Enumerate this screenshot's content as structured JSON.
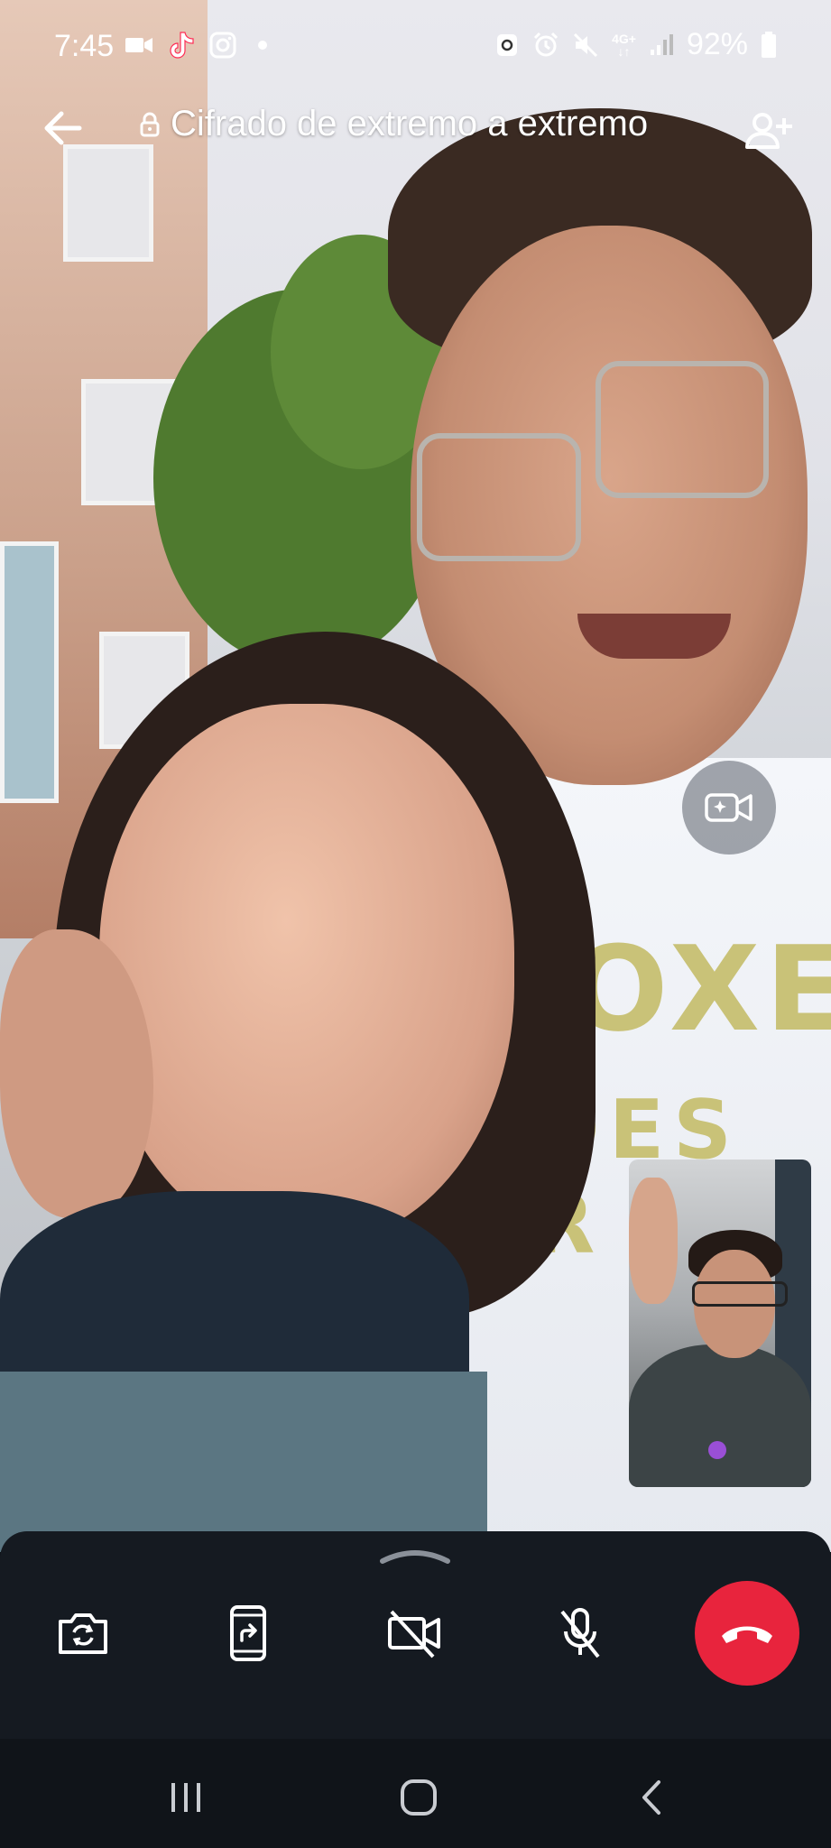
{
  "status_bar": {
    "time": "7:45",
    "network": "4G+",
    "battery": "92%",
    "left_icons": [
      "video-icon",
      "tiktok-icon",
      "instagram-icon",
      "dot-icon"
    ],
    "right_icons": [
      "recycle-icon",
      "alarm-icon",
      "mute-icon",
      "network-4g-icon",
      "signal-icon",
      "battery-icon"
    ]
  },
  "header": {
    "encryption_label": "Cifrado de extremo a extremo",
    "back_icon": "arrow-left-icon",
    "lock_icon": "lock-icon",
    "add_person_icon": "add-person-icon"
  },
  "effects_button": {
    "icon": "video-effects-icon"
  },
  "self_view": {
    "badge_color": "#9a4fd6"
  },
  "controls": {
    "items": [
      {
        "name": "flip-camera-button",
        "icon": "flip-camera-icon"
      },
      {
        "name": "share-screen-button",
        "icon": "share-screen-icon"
      },
      {
        "name": "camera-off-button",
        "icon": "camera-off-icon"
      },
      {
        "name": "mute-mic-button",
        "icon": "mic-off-icon"
      }
    ],
    "end_call": {
      "icon": "hangup-icon",
      "color": "#e8243d"
    }
  },
  "nav_bar": {
    "items": [
      "recents-icon",
      "home-icon",
      "back-icon"
    ]
  },
  "colors": {
    "sheet_bg": "#151a21",
    "nav_bg": "#101419",
    "end_call_red": "#e8243d"
  }
}
